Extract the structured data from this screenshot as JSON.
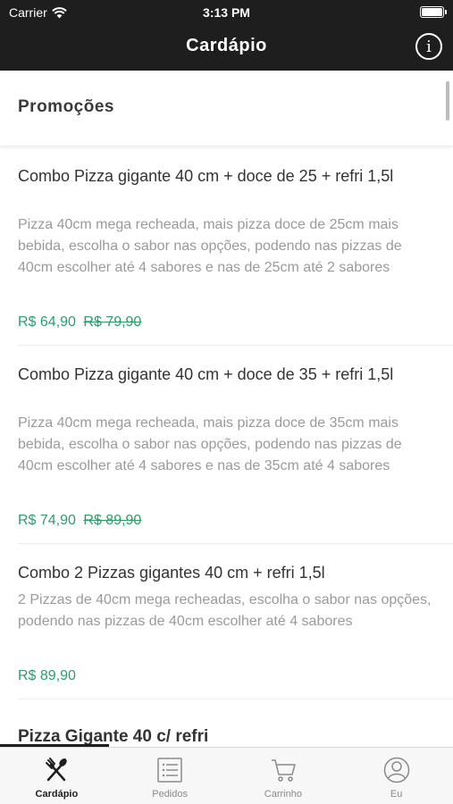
{
  "status_bar": {
    "carrier": "Carrier",
    "time": "3:13 PM"
  },
  "header": {
    "title": "Cardápio",
    "info_icon": "info-icon",
    "info_label": "i"
  },
  "section": {
    "title": "Promoções"
  },
  "items": [
    {
      "name": "Combo Pizza gigante 40 cm + doce de 25 + refri 1,5l",
      "description": "Pizza 40cm mega recheada, mais pizza doce de 25cm mais bebida, escolha o sabor nas opções, podendo nas pizzas de 40cm escolher até 4 sabores e nas de 25cm até 2 sabores",
      "price": "R$ 64,90",
      "old_price": "R$ 79,90"
    },
    {
      "name": "Combo Pizza gigante 40 cm + doce de 35 + refri 1,5l",
      "description": "Pizza 40cm mega recheada, mais pizza doce de 35cm mais bebida, escolha o sabor nas opções, podendo nas pizzas de 40cm escolher até 4 sabores e nas de 35cm até 4 sabores",
      "price": "R$ 74,90",
      "old_price": "R$ 89,90"
    },
    {
      "name": "Combo 2 Pizzas gigantes 40 cm + refri 1,5l",
      "description": "2 Pizzas de 40cm mega recheadas, escolha o sabor nas opções, podendo nas pizzas de 40cm escolher até 4 sabores",
      "price": "R$ 89,90"
    }
  ],
  "next_section": {
    "title": "Pizza Gigante 40 c/ refri"
  },
  "tabs": [
    {
      "label": "Cardápio",
      "icon": "cutlery-icon",
      "active": true
    },
    {
      "label": "Pedidos",
      "icon": "list-icon"
    },
    {
      "label": "Carrinho",
      "icon": "cart-icon"
    },
    {
      "label": "Eu",
      "icon": "user-icon"
    }
  ],
  "colors": {
    "header_bg": "#1e1e1e",
    "price_green": "#2e9b6a",
    "description_gray": "#9a9a9a"
  }
}
